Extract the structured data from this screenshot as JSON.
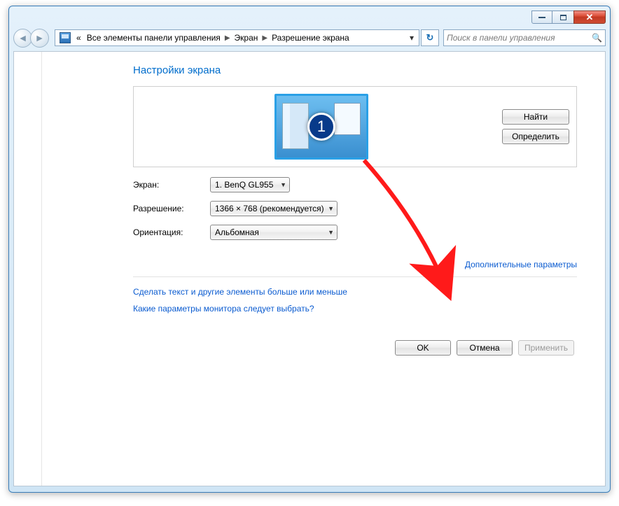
{
  "breadcrumb": {
    "root_indicator": "«",
    "seg1": "Все элементы панели управления",
    "seg2": "Экран",
    "seg3": "Разрешение экрана"
  },
  "search": {
    "placeholder": "Поиск в панели управления"
  },
  "heading": "Настройки экрана",
  "display_number": "1",
  "side_buttons": {
    "detect": "Найти",
    "identify": "Определить"
  },
  "form": {
    "display_label": "Экран:",
    "display_value": "1. BenQ GL955",
    "resolution_label": "Разрешение:",
    "resolution_value": "1366 × 768 (рекомендуется)",
    "orientation_label": "Ориентация:",
    "orientation_value": "Альбомная"
  },
  "advanced_link": "Дополнительные параметры",
  "link_resize": "Сделать текст и другие элементы больше или меньше",
  "link_which_monitor": "Какие параметры монитора следует выбрать?",
  "footer": {
    "ok": "OK",
    "cancel": "Отмена",
    "apply": "Применить"
  }
}
